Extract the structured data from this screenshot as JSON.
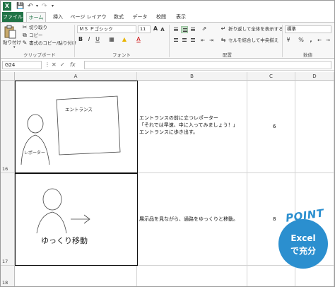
{
  "title_bar": {
    "app_icon": "X"
  },
  "tabs": [
    "ファイル",
    "ホーム",
    "挿入",
    "ページ レイアウト",
    "数式",
    "データ",
    "校閲",
    "表示"
  ],
  "ribbon": {
    "paste": "貼り付け",
    "cut": "切り取り",
    "copy": "コピー",
    "format_painter": "書式のコピー/貼り付け",
    "clipboard_label": "クリップボード",
    "font_name": "ＭＳ Ｐゴシック",
    "font_size": "11",
    "font_label": "フォント",
    "wrap_text": "折り返して全体を表示する",
    "merge_center": "セルを結合して中央揃え",
    "alignment_label": "配置",
    "number_format": "標準",
    "number_label": "数値"
  },
  "formula_bar": {
    "name_box": "G24",
    "fx": "fx",
    "value": ""
  },
  "columns": [
    "A",
    "B",
    "C",
    "D"
  ],
  "rows": [
    {
      "number": "16",
      "sketch_labels": [
        "エントランス",
        "レポーター"
      ],
      "text_lines": [
        "エントランスの前に立つレポーター",
        "「それでは早速、中に入ってみましょう！」",
        "エントランスに歩き出す。"
      ],
      "value": "6"
    },
    {
      "number": "17",
      "sketch_labels": [
        "ゆっくり移動"
      ],
      "text_lines": [
        "展示品を見ながら、通路をゆっくりと移動。"
      ],
      "value": "8"
    },
    {
      "number": "18"
    }
  ],
  "badge": {
    "point": "POINT",
    "line1": "Excel",
    "line2": "で充分"
  }
}
